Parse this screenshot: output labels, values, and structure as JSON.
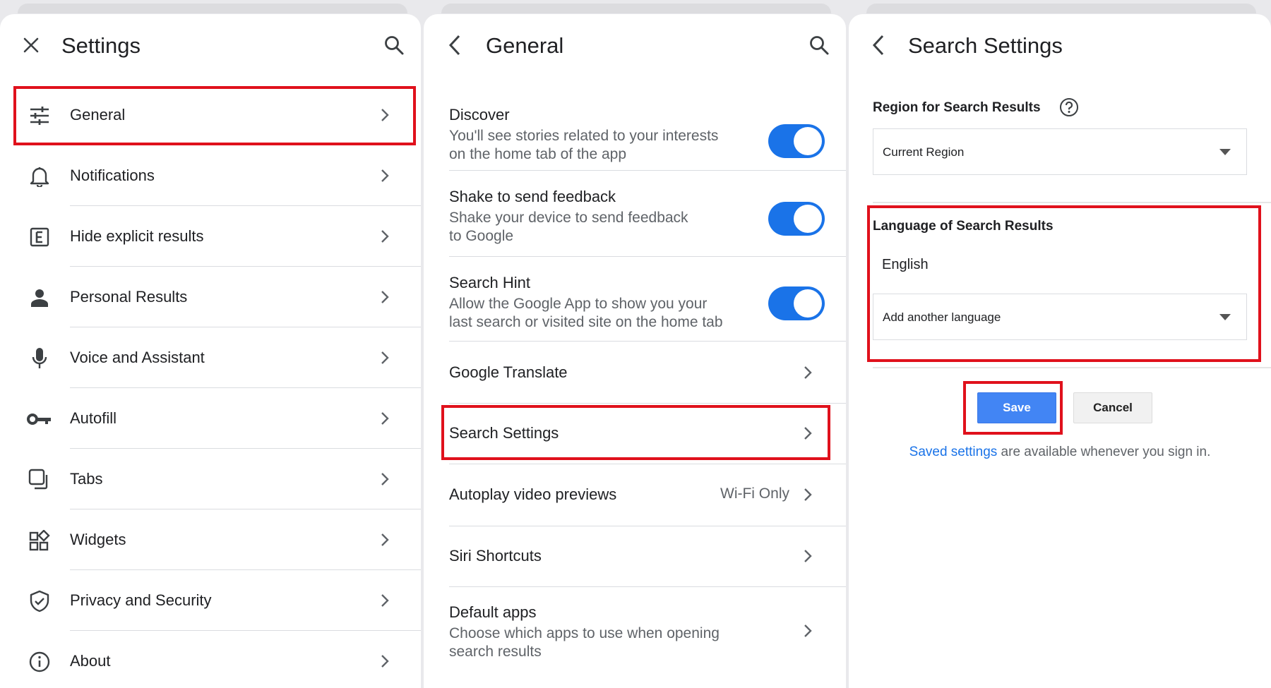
{
  "colors": {
    "accent": "#1a73e8",
    "highlight": "#e0111c",
    "text_secondary": "#5f6368"
  },
  "settings_panel": {
    "title": "Settings",
    "close_icon": "close-icon",
    "search_icon": "search-icon",
    "items": [
      {
        "label": "General",
        "icon": "tune-icon"
      },
      {
        "label": "Notifications",
        "icon": "bell-icon"
      },
      {
        "label": "Hide explicit results",
        "icon": "explicit-icon"
      },
      {
        "label": "Personal Results",
        "icon": "person-icon"
      },
      {
        "label": "Voice and Assistant",
        "icon": "mic-icon"
      },
      {
        "label": "Autofill",
        "icon": "key-icon"
      },
      {
        "label": "Tabs",
        "icon": "tabs-icon"
      },
      {
        "label": "Widgets",
        "icon": "widgets-icon"
      },
      {
        "label": "Privacy and Security",
        "icon": "shield-icon"
      },
      {
        "label": "About",
        "icon": "info-icon"
      }
    ]
  },
  "general_panel": {
    "title": "General",
    "back_icon": "back-icon",
    "search_icon": "search-icon",
    "toggles": [
      {
        "title": "Discover",
        "subtitle_1": "You'll see stories related to your interests",
        "subtitle_2": "on the home tab of the app",
        "on": true
      },
      {
        "title": "Shake to send feedback",
        "subtitle_1": "Shake your device to send feedback",
        "subtitle_2": "to Google",
        "on": true
      },
      {
        "title": "Search Hint",
        "subtitle_1": "Allow the Google App to show you your",
        "subtitle_2": "last search or visited site on the home tab",
        "on": true
      }
    ],
    "links": [
      {
        "title": "Google Translate"
      },
      {
        "title": "Search Settings"
      },
      {
        "title": "Autoplay video previews",
        "value": "Wi-Fi Only"
      },
      {
        "title": "Siri Shortcuts"
      },
      {
        "title": "Default apps",
        "subtitle_1": "Choose which apps to use when opening",
        "subtitle_2": "search results"
      }
    ]
  },
  "search_settings_panel": {
    "title": "Search Settings",
    "back_icon": "back-icon",
    "region": {
      "heading": "Region for Search Results",
      "help_icon": "help-icon",
      "selected": "Current Region"
    },
    "language": {
      "heading": "Language of Search Results",
      "current": "English",
      "add_placeholder": "Add another language"
    },
    "save_label": "Save",
    "cancel_label": "Cancel",
    "footer_link": "Saved settings",
    "footer_text": " are available whenever you sign in."
  }
}
